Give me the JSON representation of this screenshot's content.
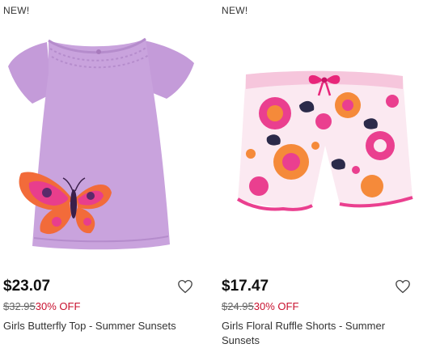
{
  "products": [
    {
      "badge": "NEW!",
      "price": "$23.07",
      "original_price": "$32.95",
      "discount": "30% OFF",
      "name": "Girls Butterfly Top - Summer Sunsets",
      "image_icon": "butterfly-top-image",
      "wishlist_icon": "heart-icon"
    },
    {
      "badge": "NEW!",
      "price": "$17.47",
      "original_price": "$24.95",
      "discount": "30% OFF",
      "name": "Girls Floral Ruffle Shorts - Summer Sunsets",
      "image_icon": "floral-shorts-image",
      "wishlist_icon": "heart-icon"
    }
  ],
  "colors": {
    "top_lavender": "#c9a3dd",
    "butterfly_orange": "#f26b3a",
    "butterfly_pink": "#e83e8c",
    "shorts_pink": "#ea3f8f",
    "shorts_orange": "#f58a3a",
    "discount_red": "#c8102e"
  }
}
